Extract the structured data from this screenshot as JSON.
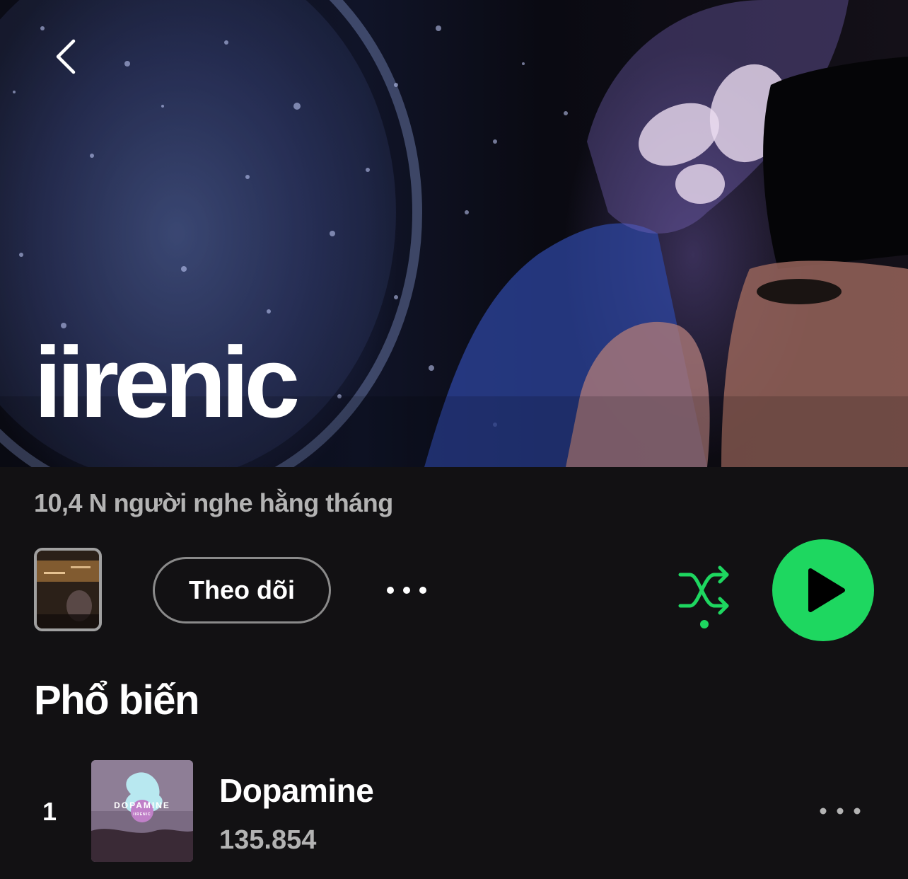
{
  "artist": {
    "name": "iirenic",
    "monthly_listeners": "10,4 N người nghe hằng tháng"
  },
  "actions": {
    "follow_label": "Theo dõi"
  },
  "popular": {
    "title": "Phổ biến",
    "tracks": [
      {
        "rank": "1",
        "title": "Dopamine",
        "plays": "135.854",
        "cover_text": "DOPAMINE",
        "cover_subtext": "IIRENIC"
      }
    ]
  },
  "colors": {
    "background": "#121113",
    "accent_green": "#1ed760",
    "secondary_text": "#b3b3b3"
  },
  "icons": {
    "back": "chevron-left-icon",
    "more": "more-horizontal-icon",
    "shuffle": "shuffle-icon",
    "play": "play-icon"
  }
}
